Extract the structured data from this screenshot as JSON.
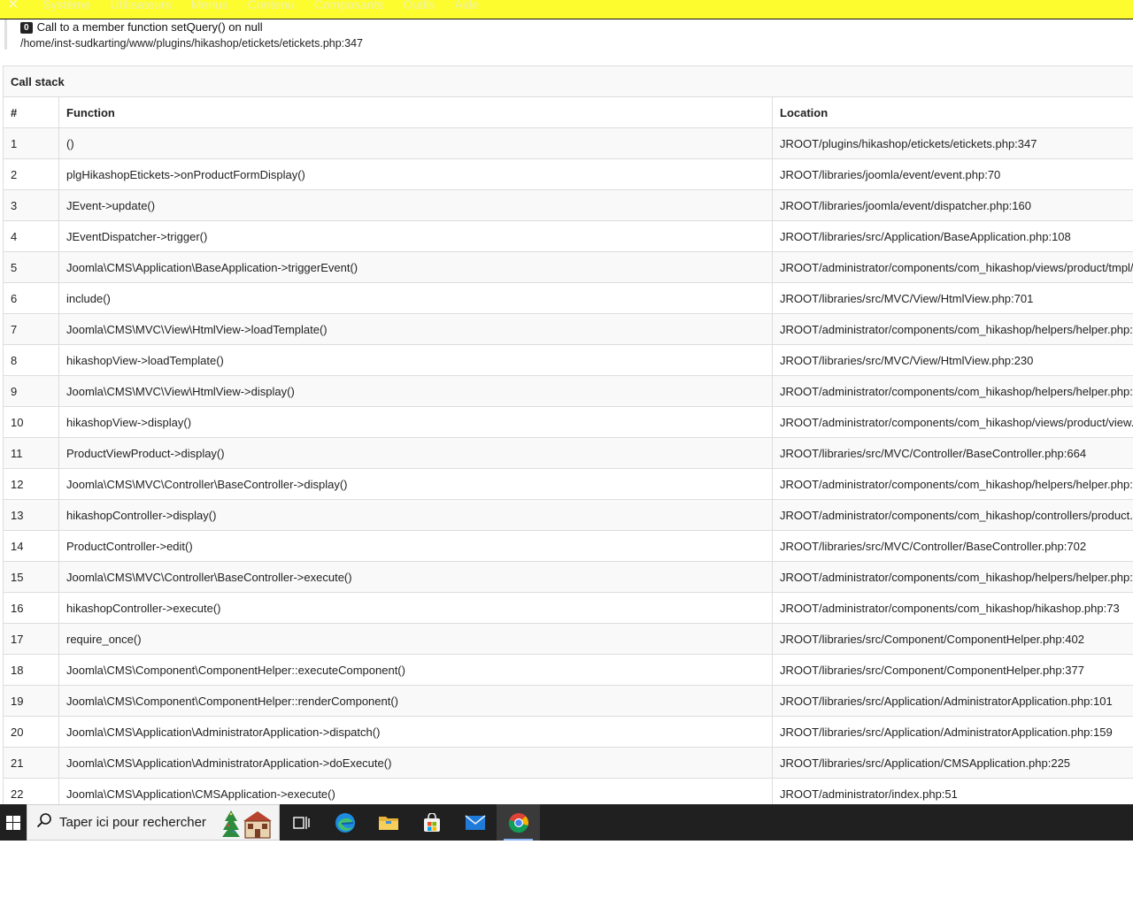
{
  "topbar": {
    "menu": [
      "Système",
      "Utilisateurs",
      "Menus",
      "Contenu",
      "Composants",
      "Outils",
      "Aide"
    ],
    "background": "#fcfc2e"
  },
  "error": {
    "code": "0",
    "message": "Call to a member function setQuery() on null",
    "path": "/home/inst-sudkarting/www/plugins/hikashop/etickets/etickets.php:347"
  },
  "callstack": {
    "title": "Call stack",
    "headers": {
      "num": "#",
      "function": "Function",
      "location": "Location"
    },
    "rows": [
      {
        "num": "1",
        "fn": "()",
        "loc": "JROOT/plugins/hikashop/etickets/etickets.php:347"
      },
      {
        "num": "2",
        "fn": "plgHikashopEtickets->onProductFormDisplay()",
        "loc": "JROOT/libraries/joomla/event/event.php:70"
      },
      {
        "num": "3",
        "fn": "JEvent->update()",
        "loc": "JROOT/libraries/joomla/event/dispatcher.php:160"
      },
      {
        "num": "4",
        "fn": "JEventDispatcher->trigger()",
        "loc": "JROOT/libraries/src/Application/BaseApplication.php:108"
      },
      {
        "num": "5",
        "fn": "Joomla\\CMS\\Application\\BaseApplication->triggerEvent()",
        "loc": "JROOT/administrator/components/com_hikashop/views/product/tmpl/"
      },
      {
        "num": "6",
        "fn": "include()",
        "loc": "JROOT/libraries/src/MVC/View/HtmlView.php:701"
      },
      {
        "num": "7",
        "fn": "Joomla\\CMS\\MVC\\View\\HtmlView->loadTemplate()",
        "loc": "JROOT/administrator/components/com_hikashop/helpers/helper.php:"
      },
      {
        "num": "8",
        "fn": "hikashopView->loadTemplate()",
        "loc": "JROOT/libraries/src/MVC/View/HtmlView.php:230"
      },
      {
        "num": "9",
        "fn": "Joomla\\CMS\\MVC\\View\\HtmlView->display()",
        "loc": "JROOT/administrator/components/com_hikashop/helpers/helper.php:"
      },
      {
        "num": "10",
        "fn": "hikashopView->display()",
        "loc": "JROOT/administrator/components/com_hikashop/views/product/view."
      },
      {
        "num": "11",
        "fn": "ProductViewProduct->display()",
        "loc": "JROOT/libraries/src/MVC/Controller/BaseController.php:664"
      },
      {
        "num": "12",
        "fn": "Joomla\\CMS\\MVC\\Controller\\BaseController->display()",
        "loc": "JROOT/administrator/components/com_hikashop/helpers/helper.php:"
      },
      {
        "num": "13",
        "fn": "hikashopController->display()",
        "loc": "JROOT/administrator/components/com_hikashop/controllers/product."
      },
      {
        "num": "14",
        "fn": "ProductController->edit()",
        "loc": "JROOT/libraries/src/MVC/Controller/BaseController.php:702"
      },
      {
        "num": "15",
        "fn": "Joomla\\CMS\\MVC\\Controller\\BaseController->execute()",
        "loc": "JROOT/administrator/components/com_hikashop/helpers/helper.php:"
      },
      {
        "num": "16",
        "fn": "hikashopController->execute()",
        "loc": "JROOT/administrator/components/com_hikashop/hikashop.php:73"
      },
      {
        "num": "17",
        "fn": "require_once()",
        "loc": "JROOT/libraries/src/Component/ComponentHelper.php:402"
      },
      {
        "num": "18",
        "fn": "Joomla\\CMS\\Component\\ComponentHelper::executeComponent()",
        "loc": "JROOT/libraries/src/Component/ComponentHelper.php:377"
      },
      {
        "num": "19",
        "fn": "Joomla\\CMS\\Component\\ComponentHelper::renderComponent()",
        "loc": "JROOT/libraries/src/Application/AdministratorApplication.php:101"
      },
      {
        "num": "20",
        "fn": "Joomla\\CMS\\Application\\AdministratorApplication->dispatch()",
        "loc": "JROOT/libraries/src/Application/AdministratorApplication.php:159"
      },
      {
        "num": "21",
        "fn": "Joomla\\CMS\\Application\\AdministratorApplication->doExecute()",
        "loc": "JROOT/libraries/src/Application/CMSApplication.php:225"
      },
      {
        "num": "22",
        "fn": "Joomla\\CMS\\Application\\CMSApplication->execute()",
        "loc": "JROOT/administrator/index.php:51"
      }
    ]
  },
  "taskbar": {
    "search_placeholder": "Taper ici pour rechercher",
    "apps": [
      "task-view-icon",
      "edge-icon",
      "file-explorer-icon",
      "store-icon",
      "mail-icon",
      "chrome-icon"
    ],
    "background": "#202020"
  }
}
